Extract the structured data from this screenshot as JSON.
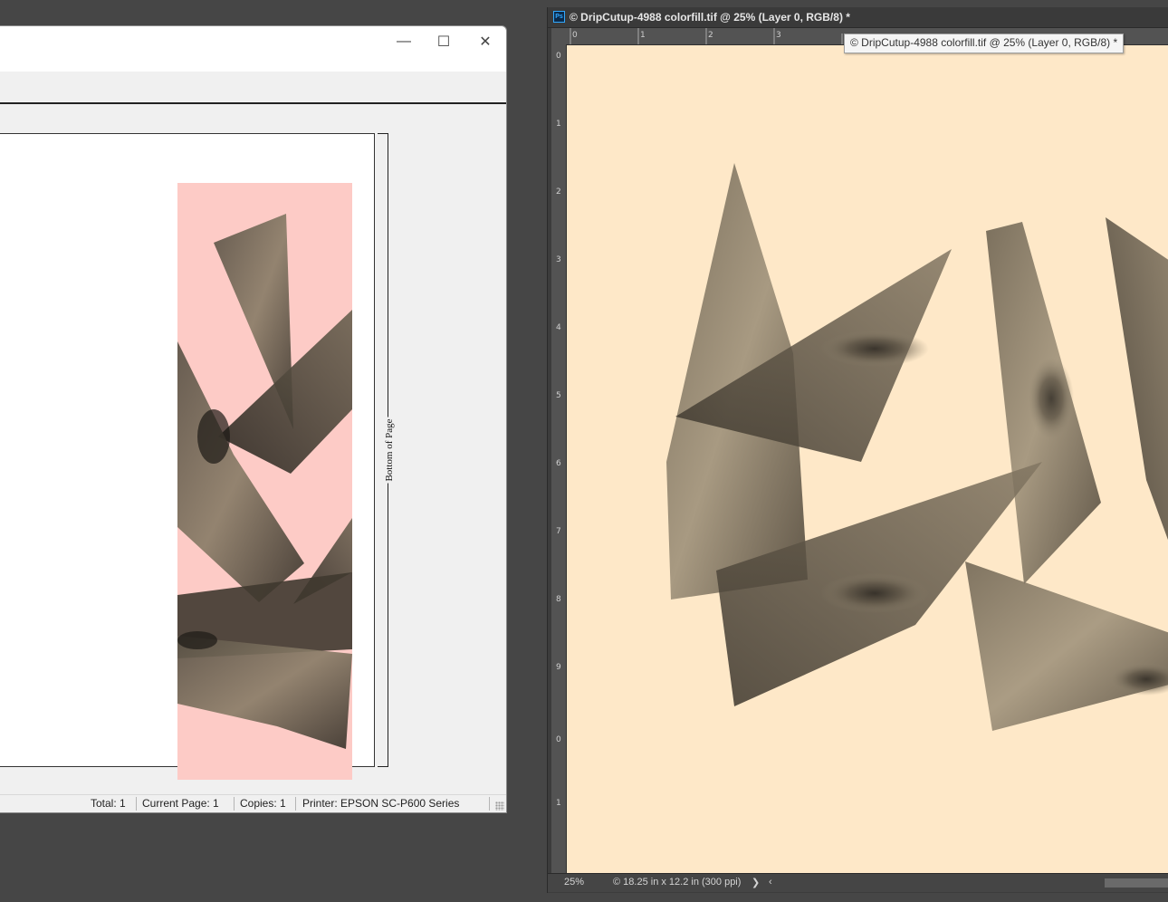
{
  "print_preview": {
    "window_controls": {
      "minimize": "—",
      "maximize": "☐",
      "close": "✕"
    },
    "page_label": "Bottom of Page",
    "status": {
      "total": "Total: 1",
      "current_page": "Current Page: 1",
      "copies": "Copies: 1",
      "printer": "Printer: EPSON SC-P600 Series"
    },
    "image_background": "#fdcbc6"
  },
  "photoshop": {
    "app_icon": "Ps",
    "document_title": "© DripCutup-4988 colorfill.tif @ 25% (Layer 0, RGB/8) *",
    "tooltip": "© DripCutup-4988 colorfill.tif @ 25% (Layer 0, RGB/8) *",
    "canvas_background": "#fee8c8",
    "ruler_h_ticks": [
      "0",
      "1",
      "2",
      "3"
    ],
    "ruler_v_ticks": [
      "0",
      "1",
      "2",
      "3",
      "4",
      "5",
      "6",
      "7",
      "8",
      "9",
      "0",
      "1"
    ],
    "status": {
      "zoom": "25%",
      "doc_info": "© 18.25 in x 12.2 in (300 ppi)",
      "next_arrow": "❯",
      "prev_arrow": "‹"
    }
  }
}
